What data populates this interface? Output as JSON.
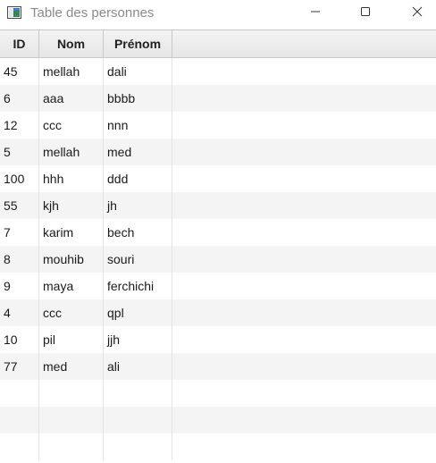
{
  "window": {
    "title": "Table des personnes",
    "icon": "app-window-icon",
    "controls": [
      "minimize-icon",
      "maximize-icon",
      "close-icon"
    ]
  },
  "table": {
    "columns": [
      "ID",
      "Nom",
      "Prénom"
    ],
    "rows": [
      {
        "id": "45",
        "nom": "mellah",
        "prenom": "dali"
      },
      {
        "id": "6",
        "nom": "aaa",
        "prenom": "bbbb"
      },
      {
        "id": "12",
        "nom": "ccc",
        "prenom": "nnn"
      },
      {
        "id": "5",
        "nom": "mellah",
        "prenom": "med"
      },
      {
        "id": "100",
        "nom": "hhh",
        "prenom": "ddd"
      },
      {
        "id": "55",
        "nom": "kjh",
        "prenom": "jh"
      },
      {
        "id": "7",
        "nom": "karim",
        "prenom": "bech"
      },
      {
        "id": "8",
        "nom": "mouhib",
        "prenom": "souri"
      },
      {
        "id": "9",
        "nom": "maya",
        "prenom": "ferchichi"
      },
      {
        "id": "4",
        "nom": "ccc",
        "prenom": "qpl"
      },
      {
        "id": "10",
        "nom": "pil",
        "prenom": "jjh"
      },
      {
        "id": "77",
        "nom": "med",
        "prenom": "ali"
      }
    ],
    "colors": {
      "header_border": "#c8c8c8",
      "row_alt": "#f4f4f4",
      "title_text": "#8a8a8a"
    }
  }
}
